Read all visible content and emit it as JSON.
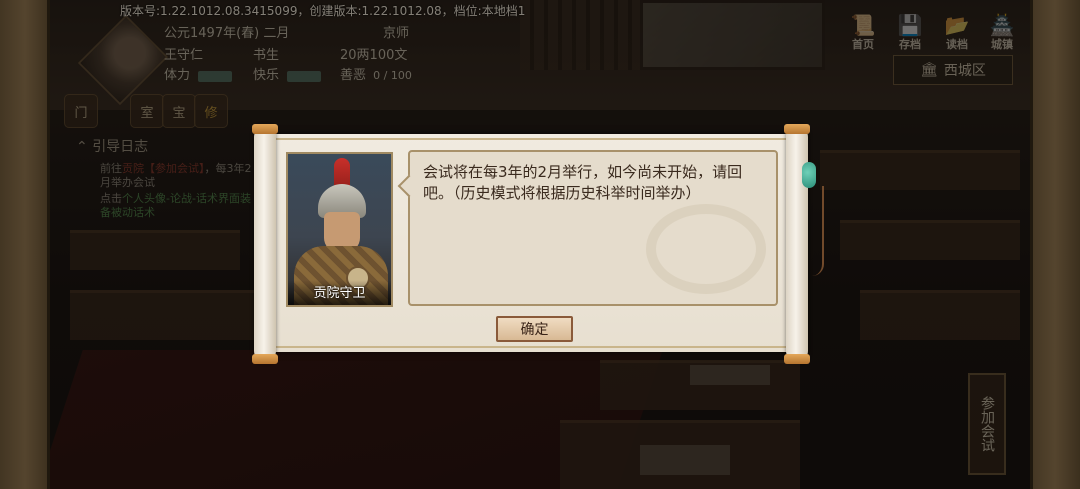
{
  "version_text": "版本号:1.22.1012.08.3415099，创建版本:1.22.1012.08，档位:本地档1",
  "hud": {
    "date": "公元1497年(春) 二月",
    "location": "京师",
    "name": "王守仁",
    "occupation": "书生",
    "money": "20两100文",
    "stamina_label": "体力",
    "happiness_label": "快乐",
    "morality_label": "善恶",
    "morality_value": "0 / 100",
    "icons": [
      "门",
      "室",
      "宝",
      "修"
    ]
  },
  "toolbar": [
    {
      "label": "首页",
      "icon": "scroll-icon"
    },
    {
      "label": "存档",
      "icon": "save-icon"
    },
    {
      "label": "读档",
      "icon": "load-icon"
    },
    {
      "label": "城镇",
      "icon": "town-icon"
    }
  ],
  "district": {
    "label": "西城区",
    "icon": "building-icon"
  },
  "guide": {
    "title": "引导日志",
    "item1_prefix": "前往",
    "item1_place": "贡院【参加会试】",
    "item1_suffix": "，每3年2月举办会试",
    "item2_prefix": "点击",
    "item2_highlight": "个人头像-论战-话术界面",
    "item2_suffix": "装备被动话术"
  },
  "side_button": {
    "label": "参加会试"
  },
  "dialog": {
    "speaker": "贡院守卫",
    "message": "会试将在每3年的2月举行，如今尚未开始，请回吧。（历史模式将根据历史科举时间举办）",
    "confirm_label": "确定"
  }
}
